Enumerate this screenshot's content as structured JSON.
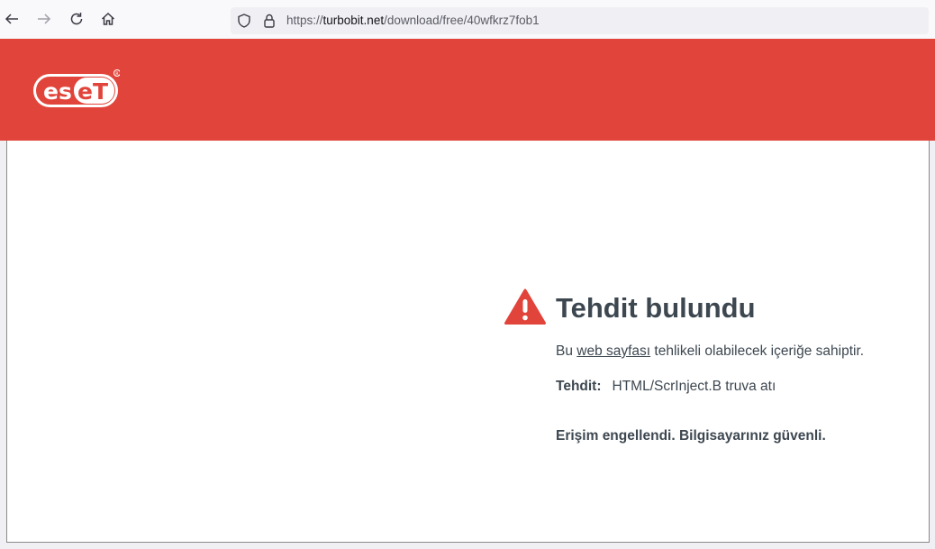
{
  "browser": {
    "url_prefix": "https://",
    "url_domain": "turbobit.net",
    "url_path": "/download/free/40wfkrz7fob1"
  },
  "brand": {
    "logo_text": "eset",
    "color": "#e1443a"
  },
  "warning": {
    "title": "Tehdit bulundu",
    "desc_before": "Bu ",
    "desc_link": "web sayfası",
    "desc_after": " tehlikeli olabilecek içeriğe sahiptir.",
    "threat_label": "Tehdit:",
    "threat_value": "HTML/ScrInject.B truva atı",
    "blocked_text": "Erişim engellendi. Bilgisayarınız güvenli."
  }
}
